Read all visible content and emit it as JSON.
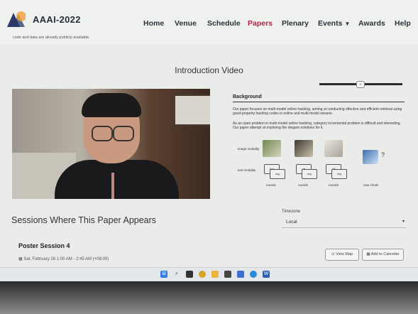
{
  "brand": {
    "name": "AAAI-2022"
  },
  "nav": [
    {
      "label": "Home",
      "active": false
    },
    {
      "label": "Venue",
      "active": false
    },
    {
      "label": "Schedule",
      "active": false
    },
    {
      "label": "Papers",
      "active": true
    },
    {
      "label": "Plenary",
      "active": false
    },
    {
      "label": "Events",
      "active": false
    },
    {
      "label": "Awards",
      "active": false
    },
    {
      "label": "Help",
      "active": false
    }
  ],
  "note": "code and data are already publicly available.",
  "video_section": {
    "title": "Introduction Video"
  },
  "slide": {
    "heading": "Background",
    "para1": "Our paper focuses on multi-model online hashing, aiming at conducting effective and efficient retrieval using good-property hashing codes in online and multi-model senario.",
    "para2": "As an open problem in multi-model online hashing, category incremental problem is difficult and interesting. Our paper attempt at exploring the elegant solutions for it.",
    "image_modality": "image modality",
    "text_modality": "text modality",
    "rounds": [
      "round1",
      "round2",
      "round3",
      "new chunk"
    ],
    "question": "?"
  },
  "sessions": {
    "title": "Sessions Where This Paper Appears",
    "timezone_label": "Timezone",
    "timezone_value": "Local",
    "poster": {
      "title": "Poster Session 4",
      "time": "Sat, February 26 1:00 AM - 2:45 AM (+08:00)",
      "view_map": "View Map",
      "add_calendar": "Add to Calendar"
    }
  },
  "colors": {
    "active_nav": "#b0224a",
    "page_bg": "#e9ece9"
  }
}
